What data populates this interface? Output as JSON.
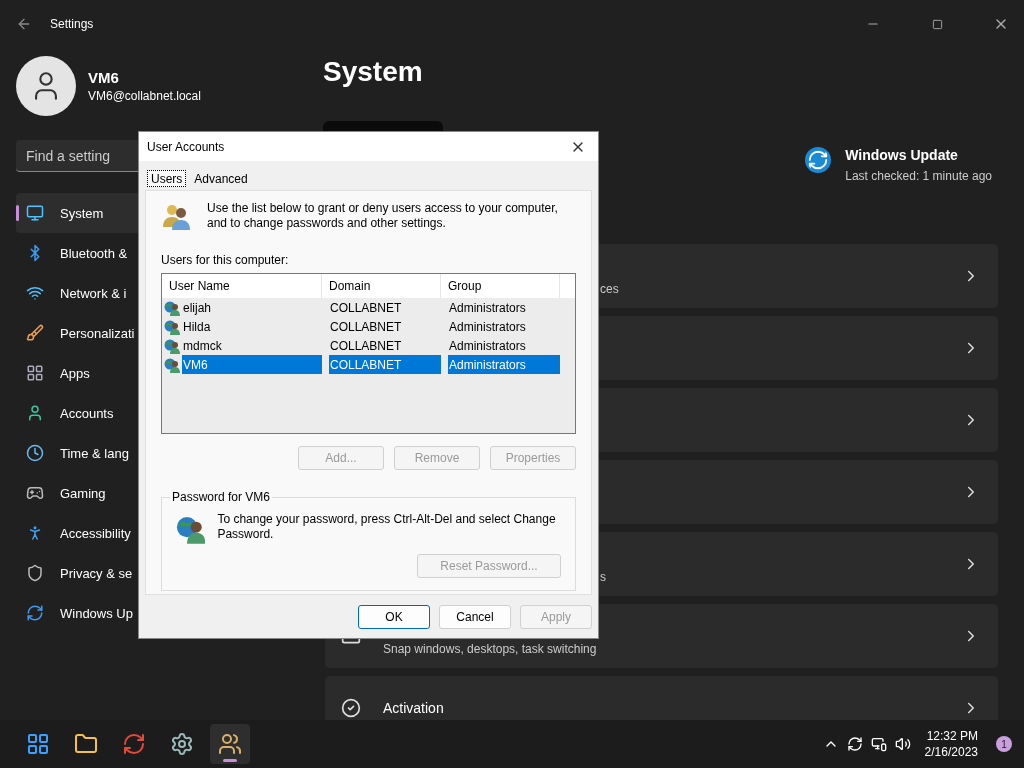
{
  "window": {
    "title": "Settings"
  },
  "profile": {
    "name": "VM6",
    "email": "VM6@collabnet.local"
  },
  "search": {
    "placeholder": "Find a setting"
  },
  "sidebar": {
    "items": [
      {
        "label": "System",
        "selected": true
      },
      {
        "label": "Bluetooth &",
        "selected": false
      },
      {
        "label": "Network & i",
        "selected": false
      },
      {
        "label": "Personalizati",
        "selected": false
      },
      {
        "label": "Apps",
        "selected": false
      },
      {
        "label": "Accounts",
        "selected": false
      },
      {
        "label": "Time & lang",
        "selected": false
      },
      {
        "label": "Gaming",
        "selected": false
      },
      {
        "label": "Accessibility",
        "selected": false
      },
      {
        "label": "Privacy & se",
        "selected": false
      },
      {
        "label": "Windows Up",
        "selected": false
      }
    ]
  },
  "main": {
    "heading": "System",
    "update": {
      "title": "Windows Update",
      "subtitle": "Last checked: 1 minute ago"
    },
    "cards": [
      {
        "kind": "partial",
        "subtitle": "ces"
      },
      {
        "kind": "partial"
      },
      {
        "kind": "partial"
      },
      {
        "kind": "partial"
      },
      {
        "kind": "partial",
        "subtitle": "s"
      },
      {
        "kind": "full",
        "subtitle": "Snap windows, desktops, task switching"
      },
      {
        "kind": "full",
        "title": "Activation"
      }
    ]
  },
  "dialog": {
    "title": "User Accounts",
    "tabs": [
      {
        "label": "Users",
        "selected": true
      },
      {
        "label": "Advanced",
        "selected": false
      }
    ],
    "intro": "Use the list below to grant or deny users access to your computer, and to change passwords and other settings.",
    "list_label": "Users for this computer:",
    "columns": [
      "User Name",
      "Domain",
      "Group"
    ],
    "rows": [
      {
        "cells": [
          "elijah",
          "COLLABNET",
          "Administrators"
        ],
        "selected": false
      },
      {
        "cells": [
          "Hilda",
          "COLLABNET",
          "Administrators"
        ],
        "selected": false
      },
      {
        "cells": [
          "mdmck",
          "COLLABNET",
          "Administrators"
        ],
        "selected": false
      },
      {
        "cells": [
          "VM6",
          "COLLABNET",
          "Administrators"
        ],
        "selected": true
      }
    ],
    "list_buttons": [
      {
        "label": "Add...",
        "disabled": true
      },
      {
        "label": "Remove",
        "disabled": true
      },
      {
        "label": "Properties",
        "disabled": true
      }
    ],
    "password": {
      "legend": "Password for VM6",
      "text": "To change your password, press Ctrl-Alt-Del and select Change Password.",
      "button": {
        "label": "Reset Password...",
        "disabled": true
      }
    },
    "buttons": [
      {
        "label": "OK",
        "default": true,
        "disabled": false
      },
      {
        "label": "Cancel",
        "default": false,
        "disabled": false
      },
      {
        "label": "Apply",
        "default": false,
        "disabled": true
      }
    ]
  },
  "taskbar": {
    "apps": [
      {
        "active": false
      },
      {
        "active": false
      },
      {
        "active": false
      },
      {
        "active": false
      },
      {
        "active": true
      }
    ],
    "time": "12:32 PM",
    "date": "2/16/2023",
    "badge": "1"
  }
}
